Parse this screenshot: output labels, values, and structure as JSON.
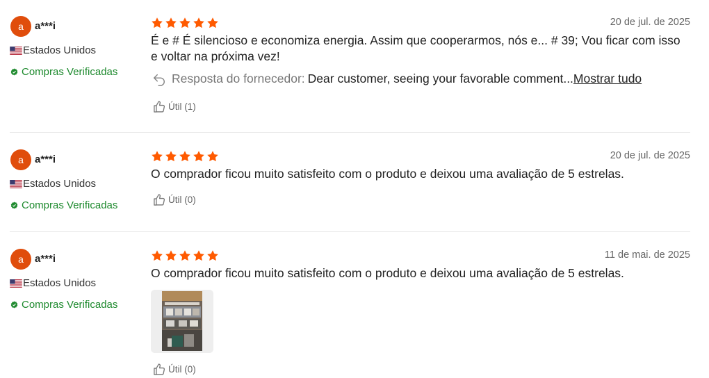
{
  "reviews": [
    {
      "avatar_letter": "a",
      "username": "a***i",
      "country": "Estados Unidos",
      "verified": "Compras Verificadas",
      "rating": 5,
      "date": "20 de jul. de 2025",
      "text": "É e # É silencioso e economiza energia. Assim que cooperarmos, nós e... # 39; Vou ficar com isso e voltar na próxima vez!",
      "reply_label": "Resposta do fornecedor:",
      "reply_text": "Dear customer, seeing your favorable comment...",
      "show_all": "Mostrar tudo",
      "helpful": "Útil (1)"
    },
    {
      "avatar_letter": "a",
      "username": "a***i",
      "country": "Estados Unidos",
      "verified": "Compras Verificadas",
      "rating": 5,
      "date": "20 de jul. de 2025",
      "text": "O comprador ficou muito satisfeito com o produto e deixou uma avaliação de 5 estrelas.",
      "helpful": "Útil (0)"
    },
    {
      "avatar_letter": "a",
      "username": "a***i",
      "country": "Estados Unidos",
      "verified": "Compras Verificadas",
      "rating": 5,
      "date": "11 de mai. de 2025",
      "text": "O comprador ficou muito satisfeito com o produto e deixou uma avaliação de 5 estrelas.",
      "helpful": "Útil (0)"
    }
  ],
  "colors": {
    "star": "#ff5a00",
    "avatar": "#e04d0c",
    "verified": "#1e8a2e"
  },
  "icons": {
    "star": "star-icon",
    "flag": "us-flag-icon",
    "verified": "verified-badge-icon",
    "reply": "reply-arrow-icon",
    "helpful": "thumbs-up-icon"
  }
}
